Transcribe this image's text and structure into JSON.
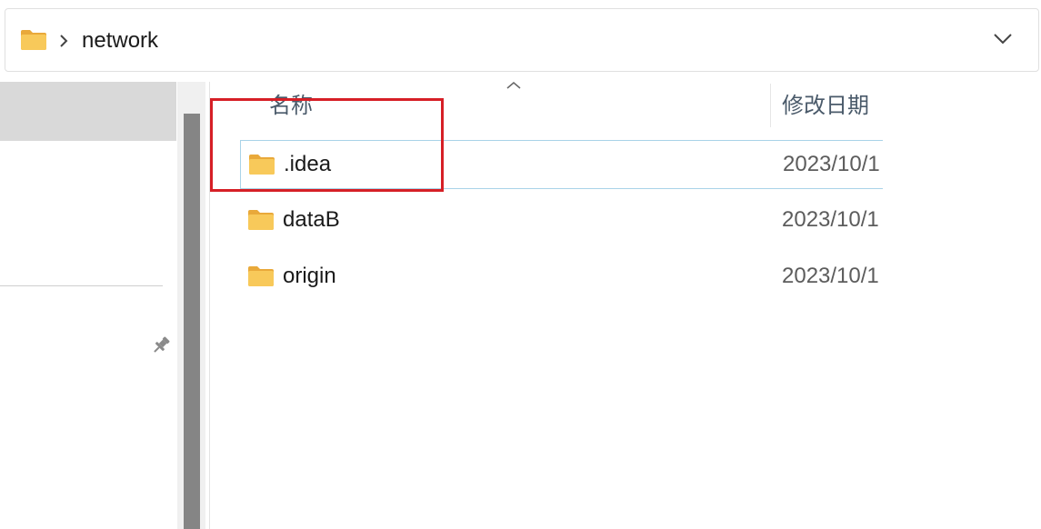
{
  "address_bar": {
    "path_label": "network",
    "folder_icon": "folder-icon",
    "separator_icon": "chevron-right-icon",
    "dropdown_icon": "chevron-down-icon"
  },
  "navigation_pane": {
    "pin_icon": "pin-icon"
  },
  "file_list": {
    "sort_indicator": "sort-ascending-icon",
    "columns": {
      "name": "名称",
      "date_modified": "修改日期"
    },
    "rows": [
      {
        "name": ".idea",
        "date": "2023/10/1",
        "type": "folder",
        "focused": true
      },
      {
        "name": "dataB",
        "date": "2023/10/1",
        "type": "folder",
        "focused": false
      },
      {
        "name": "origin",
        "date": "2023/10/1",
        "type": "folder",
        "focused": false
      }
    ]
  },
  "colors": {
    "folder_yellow": "#f8c95a",
    "folder_back": "#e9a93a",
    "selection_grey": "#d9d9d9",
    "focus_border": "#a9d3e8",
    "annotation_red": "#d61f26",
    "scrollbar_thumb": "#858585"
  }
}
